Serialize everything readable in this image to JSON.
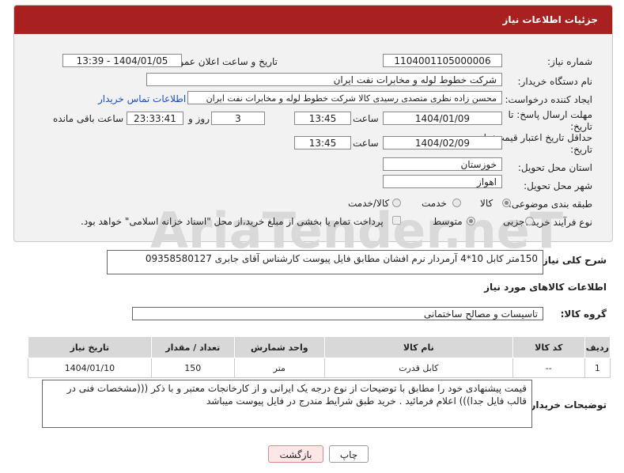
{
  "header": {
    "title": "جزئیات اطلاعات نیاز"
  },
  "fields": {
    "need_number_label": "شماره نیاز:",
    "need_number": "1104001105000006",
    "announce_label": "تاریخ و ساعت اعلان عمومی:",
    "announce_value": "1404/01/05 - 13:39",
    "buyer_org_label": "نام دستگاه خریدار:",
    "buyer_org": "شرکت خطوط لوله و مخابرات نفت ایران",
    "requester_label": "ایجاد کننده درخواست:",
    "requester": "محسن زاده نظری متصدی رسیدی کالا شرکت خطوط لوله و مخابرات نفت ایران",
    "contact_link": "اطلاعات تماس خریدار",
    "deadline_label": "مهلت ارسال پاسخ: تا تاریخ:",
    "deadline_date": "1404/01/09",
    "time_label": "ساعت",
    "deadline_time": "13:45",
    "days_value": "3",
    "day_word": "روز و",
    "remaining_time": "23:33:41",
    "remaining_label": "ساعت باقی مانده",
    "validity_label": "حداقل تاریخ اعتبار قیمت: تا تاریخ:",
    "validity_date": "1404/02/09",
    "validity_time": "13:45",
    "province_label": "استان محل تحویل:",
    "province": "خوزستان",
    "city_label": "شهر محل تحویل:",
    "city": "اهواز",
    "category_label": "طبقه بندی موضوعی:",
    "category_options": [
      "کالا",
      "خدمت",
      "کالا/خدمت"
    ],
    "process_label": "نوع فرآیند خرید :",
    "process_options": [
      "جزیی",
      "متوسط"
    ],
    "payment_note": "پرداخت تمام یا بخشی از مبلغ خرید،از محل \"اسناد خزانه اسلامی\" خواهد بود."
  },
  "summary": {
    "label": "شرح کلی نیاز:",
    "text": "150متر کابل 10*4 آرمردار نرم افشان مطابق فایل پیوست کارشناس آقای جابری 09358580127"
  },
  "goods_info": {
    "title": "اطلاعات کالاهای مورد نیاز",
    "group_label": "گروه کالا:",
    "group_value": "تاسیسات و مصالح ساختمانی"
  },
  "table": {
    "headers": [
      "ردیف",
      "کد کالا",
      "نام کالا",
      "واحد شمارش",
      "تعداد / مقدار",
      "تاریخ نیاز"
    ],
    "rows": [
      [
        "1",
        "--",
        "کابل قدرت",
        "متر",
        "150",
        "1404/01/10"
      ]
    ]
  },
  "buyer_notes": {
    "label": "توضیحات خریدار:",
    "text": "قیمت پیشنهادی خود را مطابق با توضیحات از نوع درجه یک ایرانی و از کارخانجات معتبر و با ذکر (((مشخصات فنی در قالب فایل جدا))) اعلام فرمائید . خرید طبق شرایط مندرج در فایل پیوست میباشد"
  },
  "buttons": {
    "print": "چاپ",
    "back": "بازگشت"
  },
  "watermark": "AriaTender.neT"
}
